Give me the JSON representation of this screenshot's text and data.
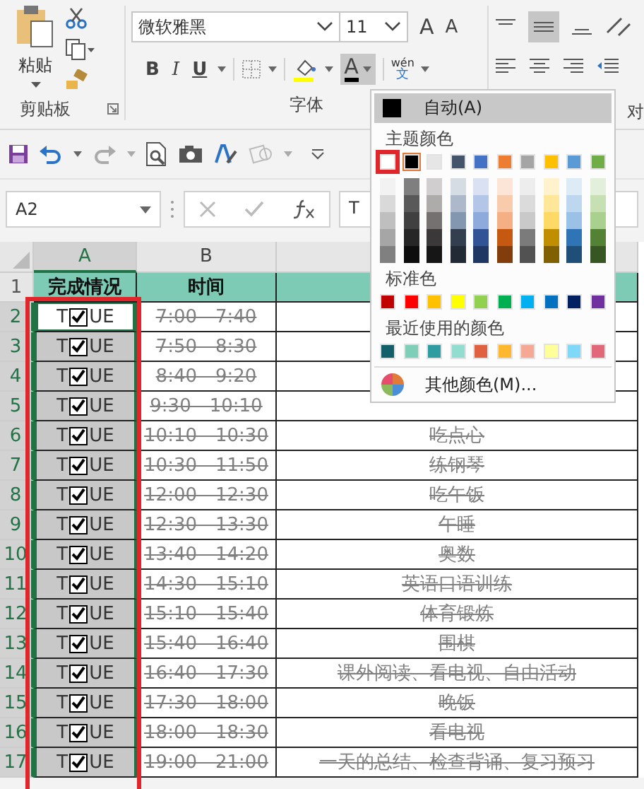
{
  "ribbon": {
    "clipboard": {
      "paste_label": "粘贴",
      "group_label": "剪贴板"
    },
    "font": {
      "font_name": "微软雅黑",
      "font_size": "11",
      "grow_font": "A",
      "shrink_font": "A",
      "bold": "B",
      "italic": "I",
      "underline": "U",
      "font_color": "A",
      "phonetic_top": "wén",
      "phonetic_bottom": "文",
      "group_label": "字体"
    },
    "alignment": {
      "group_label": "对"
    }
  },
  "name_box": "A2",
  "formula": "T",
  "columns": [
    {
      "label": "A",
      "selected": true
    },
    {
      "label": "B",
      "selected": false
    }
  ],
  "rows": [
    {
      "number": "1",
      "kind": "header",
      "selected": false,
      "a": "完成情况",
      "b": "时间"
    },
    {
      "number": "2",
      "kind": "task",
      "selected": true,
      "active": true,
      "left": "T",
      "checked": true,
      "right": "UE",
      "b": "7:00—7:40"
    },
    {
      "number": "3",
      "kind": "task",
      "selected": true,
      "active": false,
      "left": "T",
      "checked": true,
      "right": "UE",
      "b": "7:50—8:30"
    },
    {
      "number": "4",
      "kind": "task",
      "selected": true,
      "active": false,
      "left": "T",
      "checked": true,
      "right": "UE",
      "b": "8:40—9:20"
    },
    {
      "number": "5",
      "kind": "task",
      "selected": true,
      "active": false,
      "left": "T",
      "checked": true,
      "right": "UE",
      "b": "9:30—10:10"
    },
    {
      "number": "6",
      "kind": "task",
      "selected": true,
      "active": false,
      "left": "T",
      "checked": true,
      "right": "UE",
      "b": "10:10—10:30",
      "c": "吃点心"
    },
    {
      "number": "7",
      "kind": "task",
      "selected": true,
      "active": false,
      "left": "T",
      "checked": true,
      "right": "UE",
      "b": "10:30—11:50",
      "c": "练钢琴"
    },
    {
      "number": "8",
      "kind": "task",
      "selected": true,
      "active": false,
      "left": "T",
      "checked": true,
      "right": "UE",
      "b": "12:00—12:30",
      "c": "吃午饭"
    },
    {
      "number": "9",
      "kind": "task",
      "selected": true,
      "active": false,
      "left": "T",
      "checked": true,
      "right": "UE",
      "b": "12:30—13:30",
      "c": "午睡"
    },
    {
      "number": "10",
      "kind": "task",
      "selected": true,
      "active": false,
      "left": "T",
      "checked": true,
      "right": "UE",
      "b": "13:40—14:20",
      "c": "奥数"
    },
    {
      "number": "11",
      "kind": "task",
      "selected": true,
      "active": false,
      "left": "T",
      "checked": true,
      "right": "UE",
      "b": "14:30—15:10",
      "c": "英语口语训练"
    },
    {
      "number": "12",
      "kind": "task",
      "selected": true,
      "active": false,
      "left": "T",
      "checked": true,
      "right": "UE",
      "b": "15:10—15:40",
      "c": "体育锻炼"
    },
    {
      "number": "13",
      "kind": "task",
      "selected": true,
      "active": false,
      "left": "T",
      "checked": true,
      "right": "UE",
      "b": "15:40—16:40",
      "c": "围棋"
    },
    {
      "number": "14",
      "kind": "task",
      "selected": true,
      "active": false,
      "left": "T",
      "checked": true,
      "right": "UE",
      "b": "16:40—17:30",
      "c": "课外阅读、看电视、自由活动"
    },
    {
      "number": "15",
      "kind": "task",
      "selected": true,
      "active": false,
      "left": "T",
      "checked": true,
      "right": "UE",
      "b": "17:30—18:00",
      "c": "晚饭"
    },
    {
      "number": "16",
      "kind": "task",
      "selected": true,
      "active": false,
      "left": "T",
      "checked": true,
      "right": "UE",
      "b": "18:00—18:30",
      "c": "看电视"
    },
    {
      "number": "17",
      "kind": "task",
      "selected": true,
      "active": false,
      "left": "T",
      "checked": true,
      "right": "UE",
      "b": "19:00—21:00",
      "c": "一天的总结、检查背诵、复习预习"
    }
  ],
  "color_menu": {
    "auto_label": "自动(A)",
    "theme_label": "主题颜色",
    "theme_colors": [
      {
        "color": "#ffffff",
        "selected": true,
        "current": false,
        "shades": [
          {
            "color": "#f2f2f2"
          },
          {
            "color": "#d9d9d9"
          },
          {
            "color": "#bfbfbf"
          },
          {
            "color": "#a6a6a6"
          },
          {
            "color": "#808080"
          }
        ]
      },
      {
        "color": "#000000",
        "selected": false,
        "current": true,
        "shades": [
          {
            "color": "#7f7f7f"
          },
          {
            "color": "#595959"
          },
          {
            "color": "#404040"
          },
          {
            "color": "#262626"
          },
          {
            "color": "#0d0d0d"
          }
        ]
      },
      {
        "color": "#e7e6e6",
        "selected": false,
        "current": false,
        "shades": [
          {
            "color": "#d0cece"
          },
          {
            "color": "#aeabab"
          },
          {
            "color": "#757171"
          },
          {
            "color": "#3a3838"
          },
          {
            "color": "#171616"
          }
        ]
      },
      {
        "color": "#44546a",
        "selected": false,
        "current": false,
        "shades": [
          {
            "color": "#d6dce4"
          },
          {
            "color": "#adb9ca"
          },
          {
            "color": "#8497b0"
          },
          {
            "color": "#333f4f"
          },
          {
            "color": "#222b35"
          }
        ]
      },
      {
        "color": "#4472c4",
        "selected": false,
        "current": false,
        "shades": [
          {
            "color": "#d9e1f2"
          },
          {
            "color": "#b4c6e7"
          },
          {
            "color": "#8ea9db"
          },
          {
            "color": "#305496"
          },
          {
            "color": "#203764"
          }
        ]
      },
      {
        "color": "#ed7d31",
        "selected": false,
        "current": false,
        "shades": [
          {
            "color": "#fce4d6"
          },
          {
            "color": "#f8cbad"
          },
          {
            "color": "#f4b084"
          },
          {
            "color": "#c65911"
          },
          {
            "color": "#833c0c"
          }
        ]
      },
      {
        "color": "#a5a5a5",
        "selected": false,
        "current": false,
        "shades": [
          {
            "color": "#ededed"
          },
          {
            "color": "#dbdbdb"
          },
          {
            "color": "#c9c9c9"
          },
          {
            "color": "#7b7b7b"
          },
          {
            "color": "#525252"
          }
        ]
      },
      {
        "color": "#ffc000",
        "selected": false,
        "current": false,
        "shades": [
          {
            "color": "#fff2cc"
          },
          {
            "color": "#ffe699"
          },
          {
            "color": "#ffd966"
          },
          {
            "color": "#bf8f00"
          },
          {
            "color": "#806000"
          }
        ]
      },
      {
        "color": "#5b9bd5",
        "selected": false,
        "current": false,
        "shades": [
          {
            "color": "#ddebf7"
          },
          {
            "color": "#bdd7ee"
          },
          {
            "color": "#9bc2e6"
          },
          {
            "color": "#2f75b5"
          },
          {
            "color": "#1f4e78"
          }
        ]
      },
      {
        "color": "#70ad47",
        "selected": false,
        "current": false,
        "shades": [
          {
            "color": "#e2efda"
          },
          {
            "color": "#c6e0b4"
          },
          {
            "color": "#a9d08e"
          },
          {
            "color": "#548235"
          },
          {
            "color": "#375623"
          }
        ]
      }
    ],
    "standard_label": "标准色",
    "standard_colors": [
      {
        "color": "#c00000"
      },
      {
        "color": "#ff0000"
      },
      {
        "color": "#ffc000"
      },
      {
        "color": "#ffff00"
      },
      {
        "color": "#92d050"
      },
      {
        "color": "#00b050"
      },
      {
        "color": "#00b0f0"
      },
      {
        "color": "#0070c0"
      },
      {
        "color": "#002060"
      },
      {
        "color": "#7030a0"
      }
    ],
    "recent_label": "最近使用的颜色",
    "recent_colors": [
      {
        "color": "#135f6a"
      },
      {
        "color": "#7fcfb8"
      },
      {
        "color": "#2e9ca0"
      },
      {
        "color": "#92dcd0"
      },
      {
        "color": "#e0613f"
      },
      {
        "color": "#ffb72e"
      },
      {
        "color": "#f5a894"
      },
      {
        "color": "#ffff99"
      },
      {
        "color": "#80d8f8"
      },
      {
        "color": "#e06878"
      }
    ],
    "more_colors": "其他颜色(M)..."
  }
}
